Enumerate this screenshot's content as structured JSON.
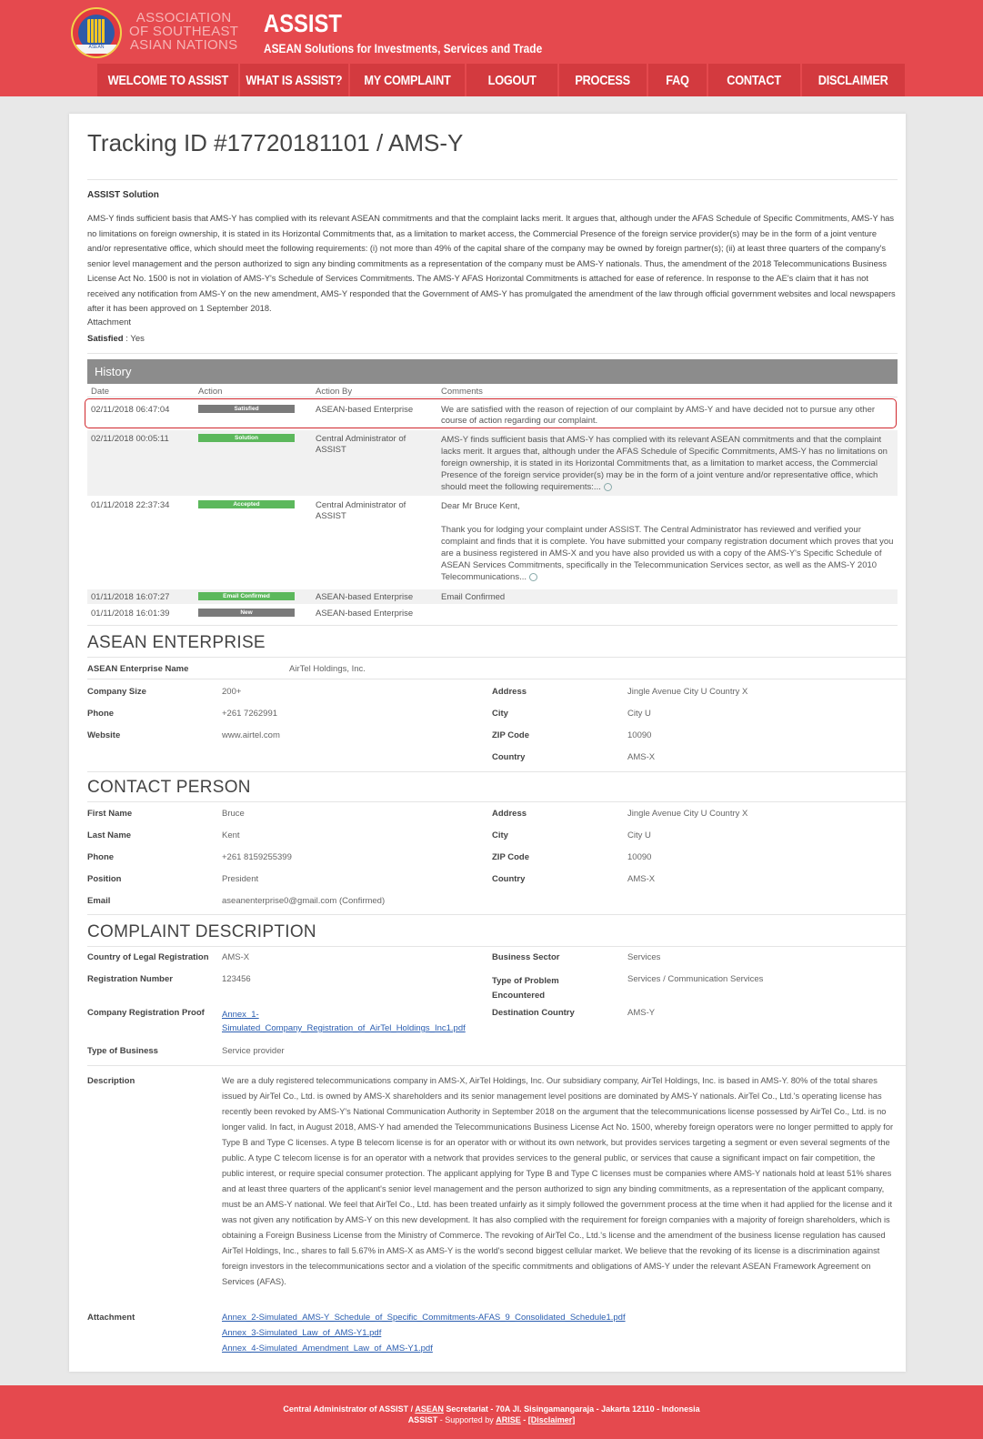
{
  "header": {
    "asean_line1": "ASSOCIATION",
    "asean_line2": "OF SOUTHEAST",
    "asean_line3": "ASIAN NATIONS",
    "logo_text": "ASEAN",
    "brand_title": "ASSIST",
    "brand_subtitle": "ASEAN Solutions for Investments, Services and Trade"
  },
  "nav": [
    {
      "label": "WELCOME TO ASSIST"
    },
    {
      "label": "WHAT IS ASSIST?"
    },
    {
      "label": "MY COMPLAINT"
    },
    {
      "label": "LOGOUT"
    },
    {
      "label": "PROCESS"
    },
    {
      "label": "FAQ"
    },
    {
      "label": "CONTACT"
    },
    {
      "label": "DISCLAIMER"
    }
  ],
  "page_title": "Tracking ID #17720181101 / AMS-Y",
  "solution": {
    "heading": "ASSIST Solution",
    "body": "AMS-Y finds sufficient basis that AMS-Y has complied with its relevant ASEAN commitments and that the complaint lacks merit. It argues that, although under the AFAS Schedule of Specific Commitments, AMS-Y has no limitations on foreign ownership, it is stated in its Horizontal Commitments that, as a limitation to market access, the Commercial Presence of the foreign service provider(s) may be in the form of a joint venture and/or representative office, which should meet the following requirements: (i) not more than 49% of the capital share of the company may be owned by foreign partner(s); (ii) at least three quarters of the company's senior level management and the person authorized to sign any binding commitments as a representation of the company must be AMS-Y nationals. Thus, the amendment of the 2018 Telecommunications Business License Act No. 1500 is not in violation of AMS-Y's Schedule of Services Commitments. The AMS-Y AFAS Horizontal Commitments is attached for ease of reference. In response to the AE's claim that it has not received any notification from AMS-Y on the new amendment, AMS-Y responded that the Government of AMS-Y has promulgated the amendment of the law through official government websites and local newspapers after it has been approved on 1 September 2018.",
    "attachment_label": "Attachment",
    "satisfied_label": "Satisfied",
    "satisfied_value": ": Yes"
  },
  "history": {
    "title": "History",
    "columns": [
      "Date",
      "Action",
      "Action By",
      "Comments"
    ],
    "rows": [
      {
        "date": "02/11/2018 06:47:04",
        "action": "Satisfied",
        "by": "ASEAN-based Enterprise",
        "comment": "We are satisfied with the reason of rejection of our complaint by AMS-Y and have decided not to pursue any other course of action regarding our complaint."
      },
      {
        "date": "02/11/2018 00:05:11",
        "action": "Solution",
        "by": "Central Administrator of ASSIST",
        "comment": "AMS-Y finds sufficient basis that AMS-Y has complied with its relevant ASEAN commitments and that the complaint lacks merit. It argues that, although under the AFAS Schedule of Specific Commitments, AMS-Y has no limitations on foreign ownership, it is stated in its Horizontal Commitments that, as a limitation to market access, the Commercial Presence of the foreign service provider(s) may be in the form of a joint venture and/or representative office, which should meet the following requirements:..."
      },
      {
        "date": "01/11/2018 22:37:34",
        "action": "Accepted",
        "by": "Central Administrator of ASSIST",
        "comment_greeting": "Dear Mr Bruce Kent,",
        "comment": "Thank you for lodging your complaint under ASSIST. The Central Administrator has reviewed and verified your complaint and finds that it is complete. You have submitted your company registration document which proves that you are a business registered in AMS-X and you have also provided us with a copy of the AMS-Y's Specific Schedule of ASEAN Services Commitments, specifically in the Telecommunication Services sector, as well as the AMS-Y 2010 Telecommunications..."
      },
      {
        "date": "01/11/2018 16:07:27",
        "action": "Email Confirmed",
        "by": "ASEAN-based Enterprise",
        "comment": "Email Confirmed"
      },
      {
        "date": "01/11/2018 16:01:39",
        "action": "New",
        "by": "ASEAN-based Enterprise",
        "comment": ""
      }
    ]
  },
  "enterprise": {
    "title": "ASEAN ENTERPRISE",
    "name_label": "ASEAN Enterprise Name",
    "name_value": "AirTel Holdings, Inc.",
    "size_label": "Company Size",
    "size_value": "200+",
    "phone_label": "Phone",
    "phone_value": "+261 7262991",
    "website_label": "Website",
    "website_value": "www.airtel.com",
    "address_label": "Address",
    "address_value": "Jingle Avenue City U Country X",
    "city_label": "City",
    "city_value": "City U",
    "zip_label": "ZIP Code",
    "zip_value": "10090",
    "country_label": "Country",
    "country_value": "AMS-X"
  },
  "contact": {
    "title": "CONTACT PERSON",
    "first_label": "First Name",
    "first_value": "Bruce",
    "last_label": "Last Name",
    "last_value": "Kent",
    "phone_label": "Phone",
    "phone_value": "+261 8159255399",
    "position_label": "Position",
    "position_value": "President",
    "email_label": "Email",
    "email_value": "aseanenterprise0@gmail.com (Confirmed)",
    "address_label": "Address",
    "address_value": "Jingle Avenue City U Country X",
    "city_label": "City",
    "city_value": "City U",
    "zip_label": "ZIP Code",
    "zip_value": "10090",
    "country_label": "Country",
    "country_value": "AMS-X"
  },
  "complaint": {
    "title": "COMPLAINT DESCRIPTION",
    "country_label": "Country of Legal Registration",
    "country_value": "AMS-X",
    "regnum_label": "Registration Number",
    "regnum_value": "123456",
    "proof_label": "Company Registration Proof",
    "proof_line1": "Annex_1-",
    "proof_line2": "Simulated_Company_Registration_of_AirTel_Holdings_Inc1.pdf",
    "business_type_label": "Type of Business",
    "business_type_value": "Service provider",
    "sector_label": "Business Sector",
    "sector_value": "Services",
    "problem_label_1": "Type of Problem",
    "problem_label_2": "Encountered",
    "problem_value": "Services / Communication Services",
    "dest_label": "Destination Country",
    "dest_value": "AMS-Y",
    "description_label": "Description",
    "description": "We are a duly registered telecommunications company in AMS-X, AirTel Holdings, Inc. Our subsidiary company, AirTel Holdings, Inc. is based in AMS-Y. 80% of the total shares issued by AirTel Co., Ltd. is owned by AMS-X shareholders and its senior management level positions are dominated by AMS-Y nationals. AirTel Co., Ltd.'s operating license has recently been revoked by AMS-Y's National Communication Authority in September 2018 on the argument that the telecommunications license possessed by AirTel Co., Ltd. is no longer valid. In fact, in August 2018, AMS-Y had amended the Telecommunications Business License Act No. 1500, whereby foreign operators were no longer permitted to apply for Type B and Type C licenses. A type B telecom license is for an operator with or without its own network, but provides services targeting a segment or even several segments of the public. A type C telecom license is for an operator with a network that provides services to the general public, or services that cause a significant impact on fair competition, the public interest, or require special consumer protection. The applicant applying for Type B and Type C licenses must be companies where AMS-Y nationals hold at least 51% shares and at least three quarters of the applicant's senior level management and the person authorized to sign any binding commitments, as a representation of the applicant company, must be an AMS-Y national. We feel that AirTel Co., Ltd. has been treated unfairly as it simply followed the government process at the time when it had applied for the license and it was not given any notification by AMS-Y on this new development. It has also complied with the requirement for foreign companies with a majority of foreign shareholders, which is obtaining a Foreign Business License from the Ministry of Commerce. The revoking of AirTel Co., Ltd.'s license and the amendment of the business license regulation has caused AirTel Holdings, Inc., shares to fall 5.67% in AMS-X as AMS-Y is the world's second biggest cellular market. We believe that the revoking of its license is a discrimination against foreign investors in the telecommunications sector and a violation of the specific commitments and obligations of AMS-Y under the relevant ASEAN Framework Agreement on Services (AFAS).",
    "attachment_label": "Attachment",
    "attachments": [
      "Annex_2-Simulated_AMS-Y_Schedule_of_Specific_Commitments-AFAS_9_Consolidated_Schedule1.pdf",
      "Annex_3-Simulated_Law_of_AMS-Y1.pdf",
      "Annex_4-Simulated_Amendment_Law_of_AMS-Y1.pdf"
    ]
  },
  "footer": {
    "line1_a": "Central Administrator of ASSIST / ",
    "line1_link": "ASEAN",
    "line1_b": " Secretariat - 70A Jl. Sisingamangaraja - Jakarta 12110 - Indonesia",
    "line2_a": "ASSIST",
    "line2_b": " - Supported by ",
    "line2_link": "ARISE",
    "line2_c": " - ",
    "line2_link2": "[Disclaimer]"
  },
  "colors": {
    "brand_red": "#e5494e",
    "nav_red": "#d33a3f",
    "badge_grey": "#7a7a7a",
    "badge_green": "#5cb85c",
    "highlight_border": "#d0262c",
    "link_blue": "#2a5db0"
  }
}
